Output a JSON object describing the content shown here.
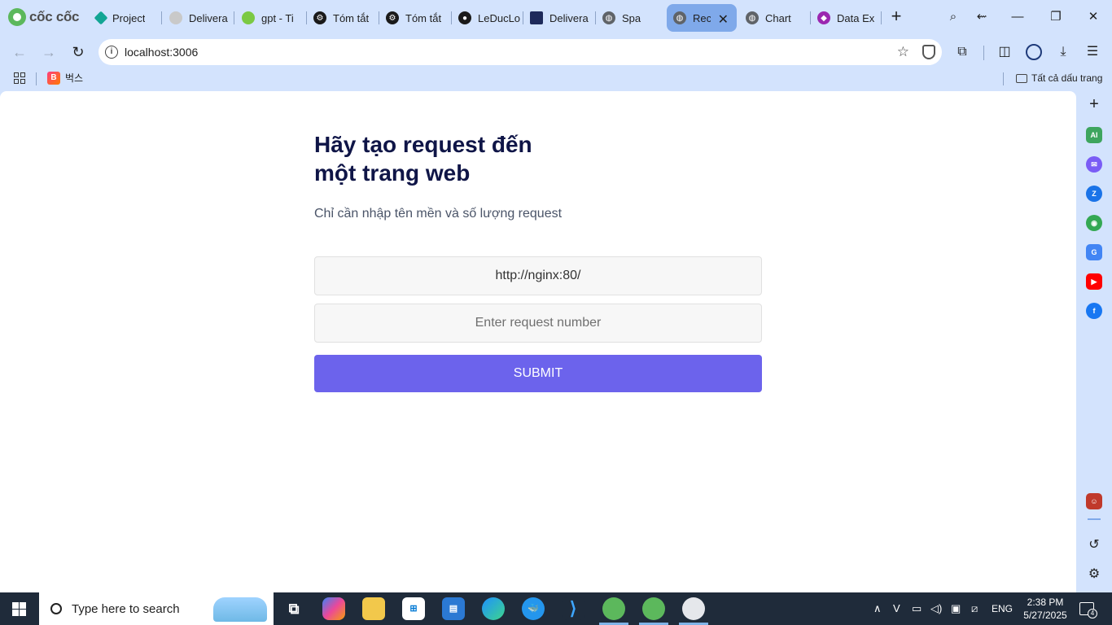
{
  "browser": {
    "brand": "cốc cốc",
    "tabs": [
      {
        "label": "Project",
        "color": "#12a594"
      },
      {
        "label": "Delivera",
        "color": "#c9c9c9"
      },
      {
        "label": "gpt - Ti",
        "color": "#7bc943"
      },
      {
        "label": "Tóm tắt",
        "color": "#1a1a1a"
      },
      {
        "label": "Tóm tắt",
        "color": "#1a1a1a"
      },
      {
        "label": "LeDucLo",
        "color": "#1a1a1a"
      },
      {
        "label": "Delivera",
        "color": "#1e2a5a"
      },
      {
        "label": "Spa",
        "color": "#5f6368"
      },
      {
        "label": "Rec",
        "color": "#5f6368"
      },
      {
        "label": "Chart",
        "color": "#5f6368"
      },
      {
        "label": "Data Ex",
        "color": "#9b27b0"
      }
    ],
    "active_tab_index": 8,
    "window_controls": {
      "minimize": "—",
      "restore": "❐",
      "close": "✕"
    },
    "address": "localhost:3006",
    "bookmarks": [
      {
        "label": "벅스",
        "icon": "B"
      }
    ],
    "all_bookmarks_label": "Tất cả dấu trang"
  },
  "page": {
    "title": "Hãy tạo request đến một trang web",
    "subtitle": "Chỉ cần nhập tên mền và số lượng request",
    "url_value": "http://nginx:80/",
    "number_placeholder": "Enter request number",
    "submit_label": "SUBMIT",
    "accent_color": "#6c63ec"
  },
  "side_panel": {
    "items": [
      "ai-icon",
      "messenger-icon",
      "zalo-icon",
      "game-icon",
      "translate-icon",
      "youtube-icon",
      "facebook-icon"
    ]
  },
  "taskbar": {
    "search_placeholder": "Type here to search",
    "language": "ENG",
    "time": "2:38 PM",
    "date": "5/27/2025",
    "notification_count": "4"
  }
}
